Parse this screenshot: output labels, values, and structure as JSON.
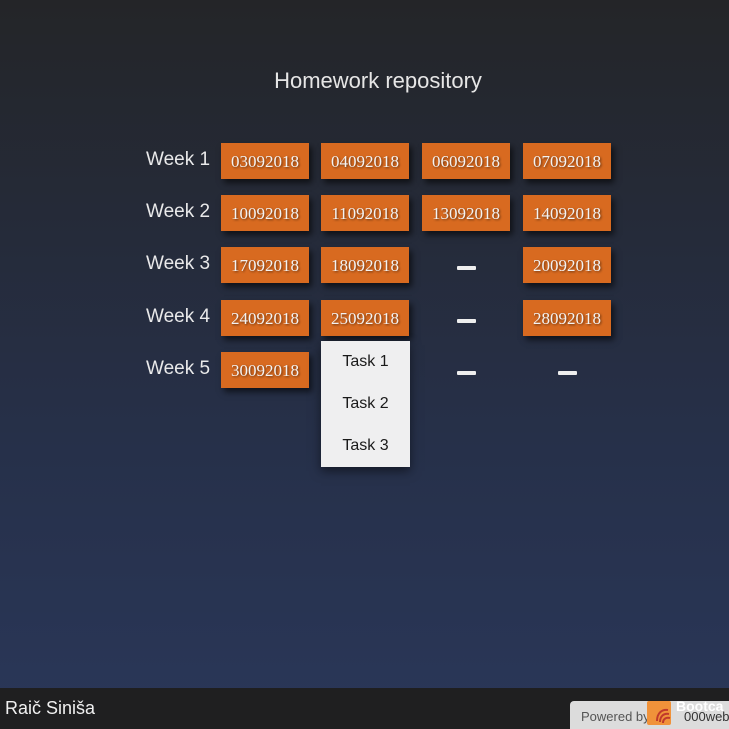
{
  "page": {
    "title": "Homework repository"
  },
  "weeks": [
    {
      "label": "Week 1",
      "dates": [
        "03092018",
        "04092018",
        "06092018",
        "07092018"
      ]
    },
    {
      "label": "Week 2",
      "dates": [
        "10092018",
        "11092018",
        "13092018",
        "14092018"
      ]
    },
    {
      "label": "Week 3",
      "dates": [
        "17092018",
        "18092018",
        "",
        "20092018"
      ]
    },
    {
      "label": "Week 4",
      "dates": [
        "24092018",
        "25092018",
        "",
        "28092018"
      ]
    },
    {
      "label": "Week 5",
      "dates": [
        "30092018",
        "",
        "",
        ""
      ]
    }
  ],
  "dropdown": {
    "items": [
      "Task 1",
      "Task 2",
      "Task 3"
    ]
  },
  "footer": {
    "author": "Raič Siniša",
    "powered_by": "Powered by",
    "brand": "Bootca",
    "host": "000web"
  },
  "colors": {
    "button": "#d86a20",
    "footer": "#1f1f20",
    "dropdown": "#efeff0"
  },
  "icons": {
    "empty_slot": "dash-icon",
    "logo": "bootcamp-logo-icon"
  }
}
